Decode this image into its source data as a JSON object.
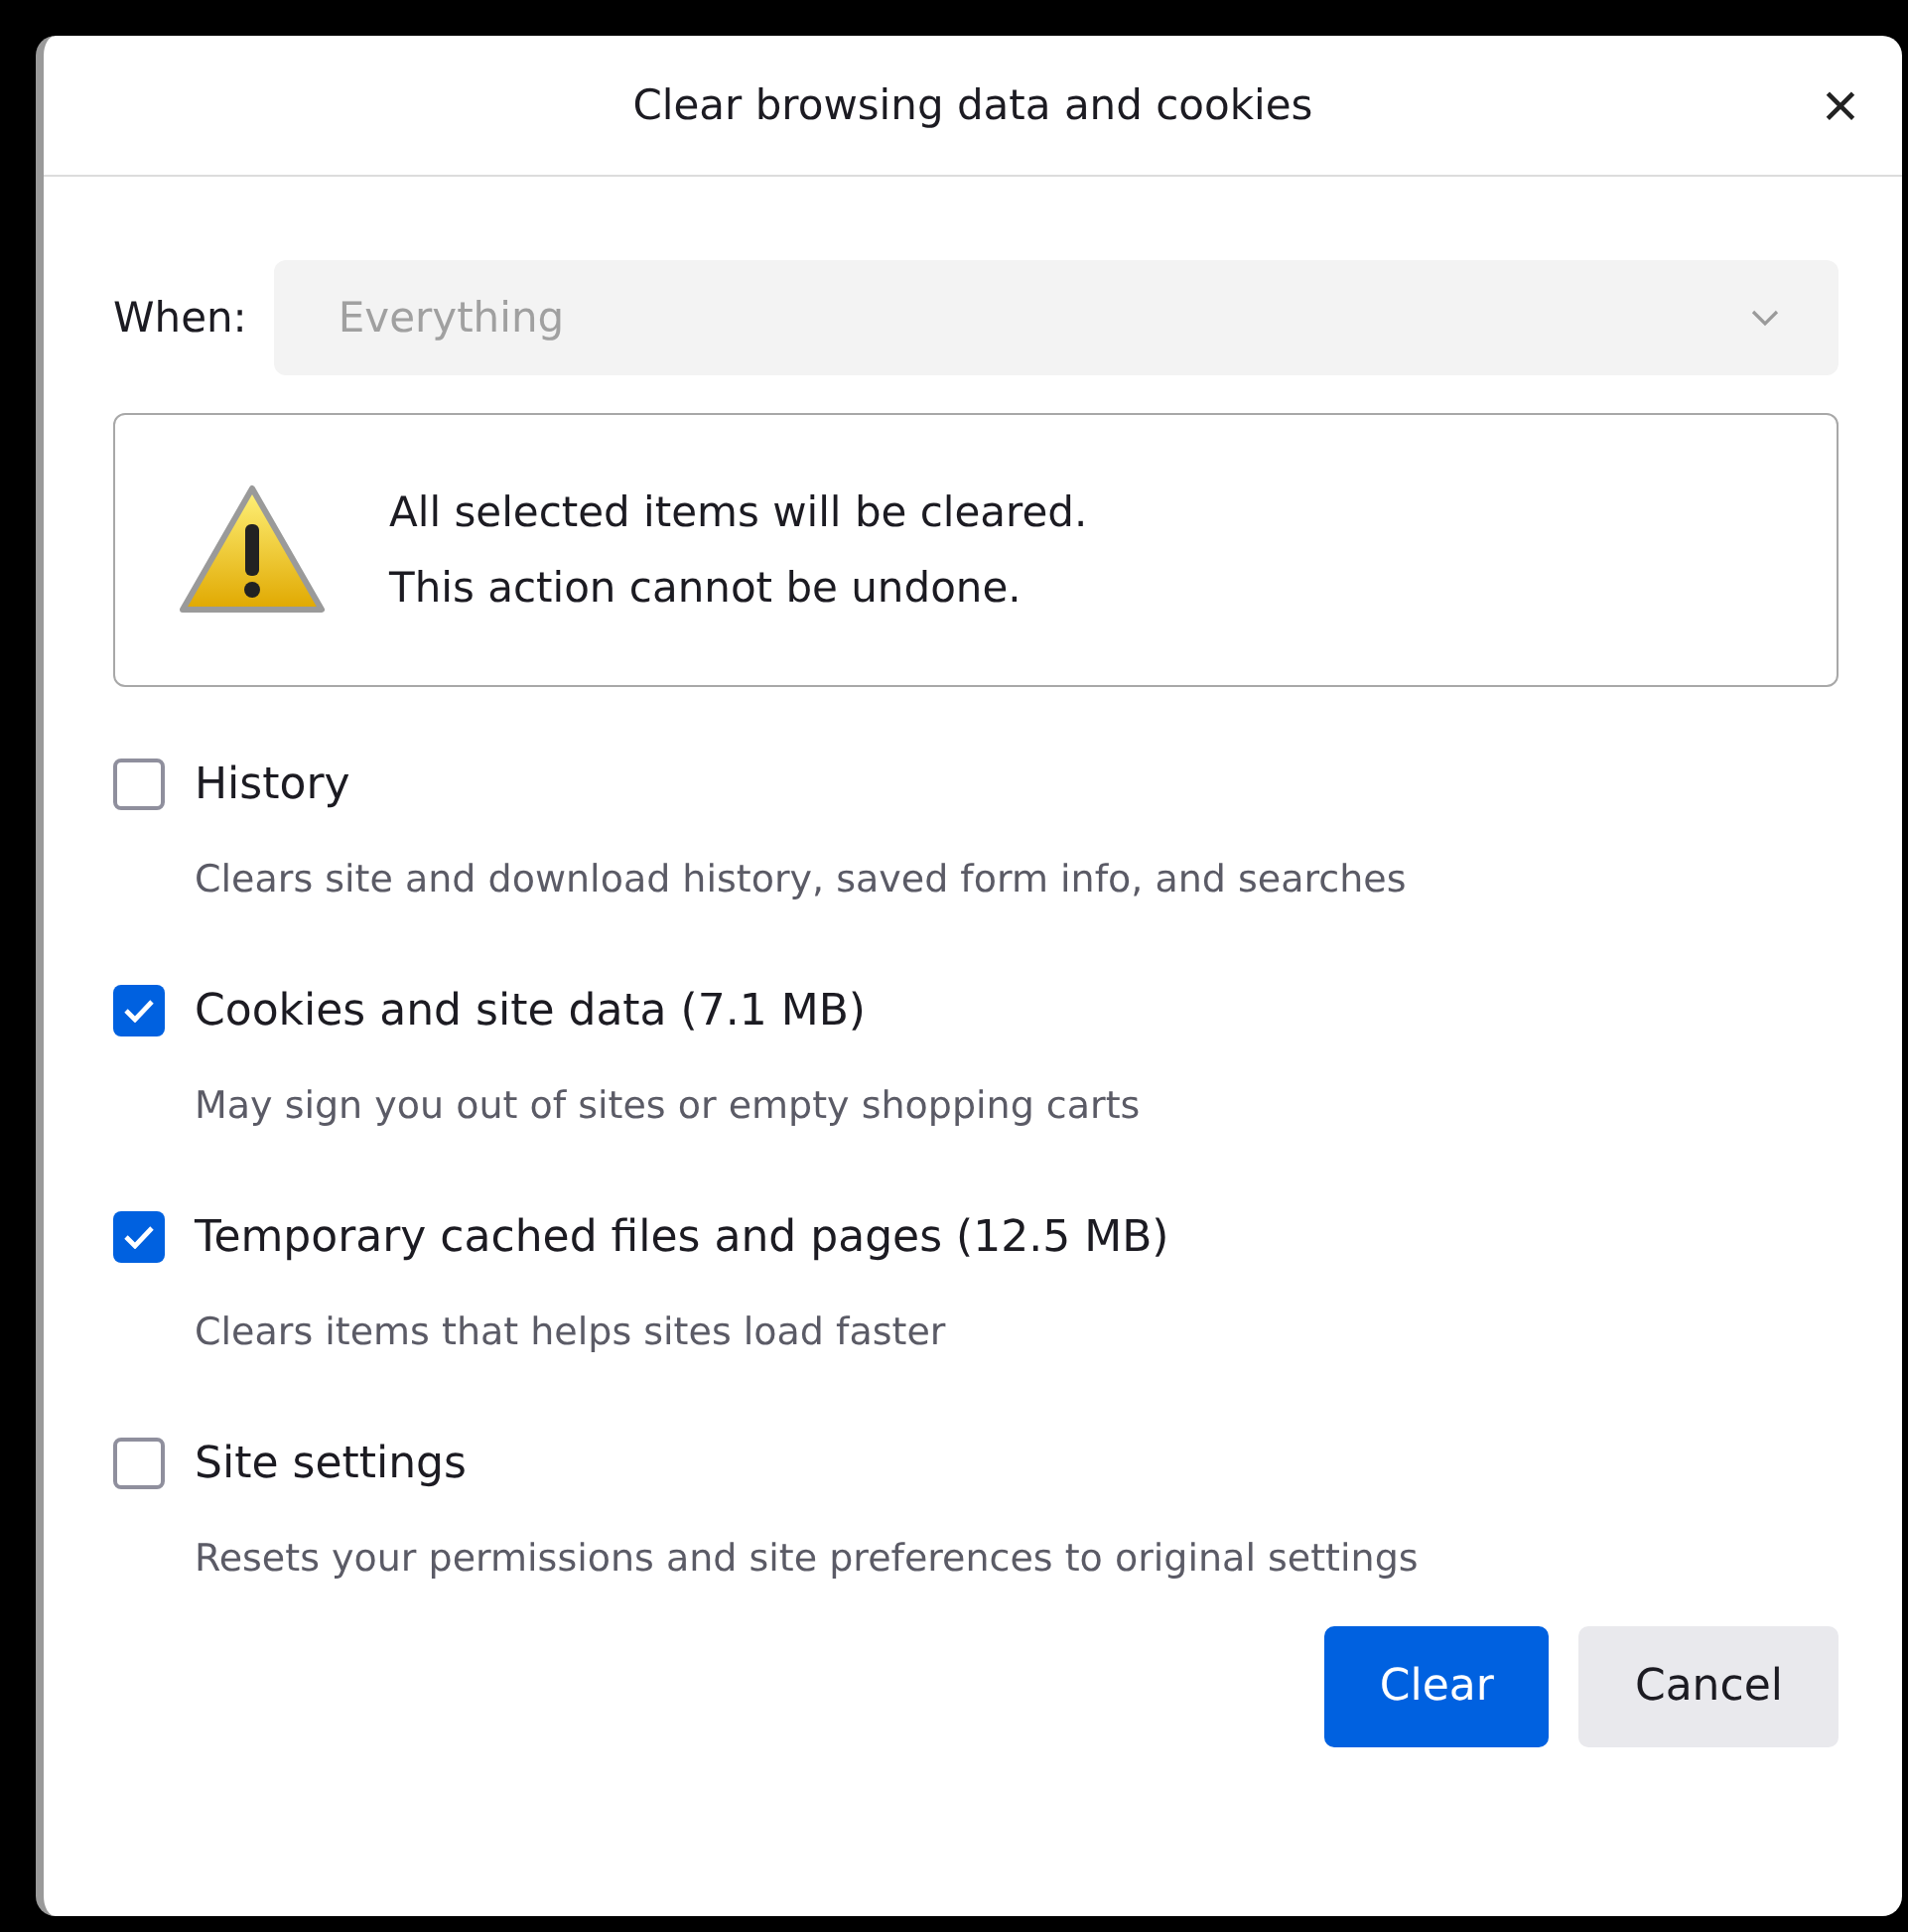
{
  "dialog": {
    "title": "Clear browsing data and cookies",
    "close": "×"
  },
  "when": {
    "label": "When:",
    "value": "Everything",
    "disabled": true
  },
  "warning": {
    "lines": [
      "All selected items will be cleared.",
      "This action cannot be undone."
    ]
  },
  "options": [
    {
      "label": "History",
      "description": "Clears site and download history, saved form info, and searches",
      "checked": false
    },
    {
      "label": "Cookies and site data (7.1 MB)",
      "description": "May sign you out of sites or empty shopping carts",
      "checked": true
    },
    {
      "label": "Temporary cached files and pages (12.5 MB)",
      "description": "Clears items that helps sites load faster",
      "checked": true
    },
    {
      "label": "Site settings",
      "description": "Resets your permissions and site preferences to original settings",
      "checked": false
    }
  ],
  "buttons": [
    {
      "label": "Clear",
      "kind": "primary"
    },
    {
      "label": "Cancel",
      "kind": "secondary"
    }
  ]
}
